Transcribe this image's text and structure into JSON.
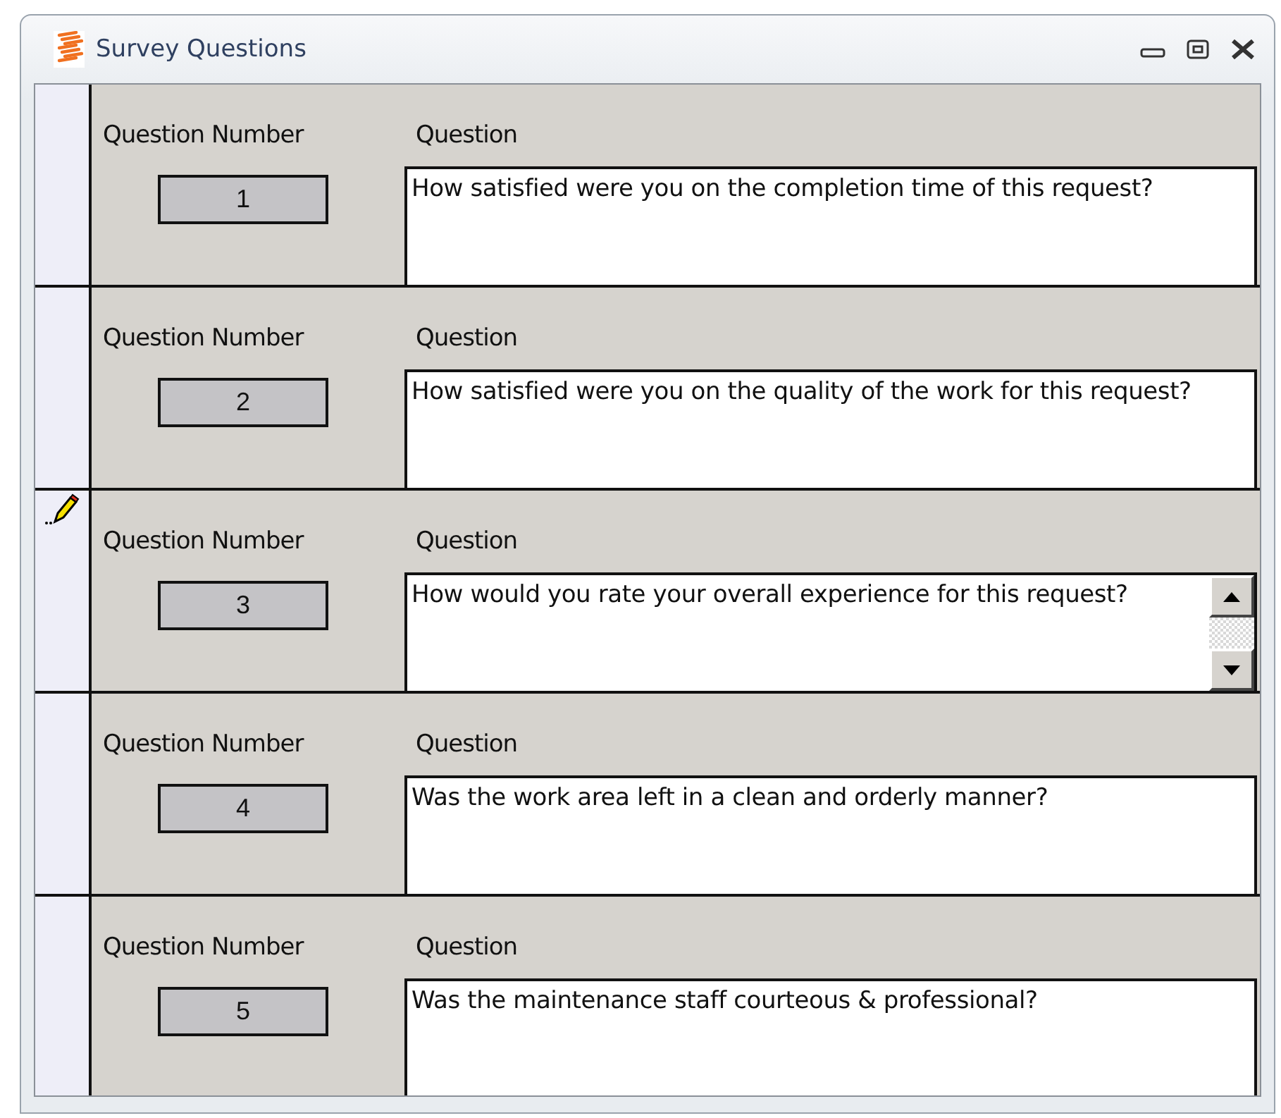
{
  "window": {
    "title": "Survey Questions"
  },
  "records": [
    {
      "number_label": "Question Number",
      "number": "1",
      "question_label": "Question",
      "question": "How satisfied were you on the completion time of this request?",
      "editing": false
    },
    {
      "number_label": "Question Number",
      "number": "2",
      "question_label": "Question",
      "question": "How satisfied were you on the quality of the work for this request?",
      "editing": false
    },
    {
      "number_label": "Question Number",
      "number": "3",
      "question_label": "Question",
      "question": "How would you rate your overall experience for this request?",
      "editing": true
    },
    {
      "number_label": "Question Number",
      "number": "4",
      "question_label": "Question",
      "question": "Was the work area left in a clean and orderly manner?",
      "editing": false
    },
    {
      "number_label": "Question Number",
      "number": "5",
      "question_label": "Question",
      "question": "Was the maintenance staff courteous & professional?",
      "editing": false
    }
  ]
}
